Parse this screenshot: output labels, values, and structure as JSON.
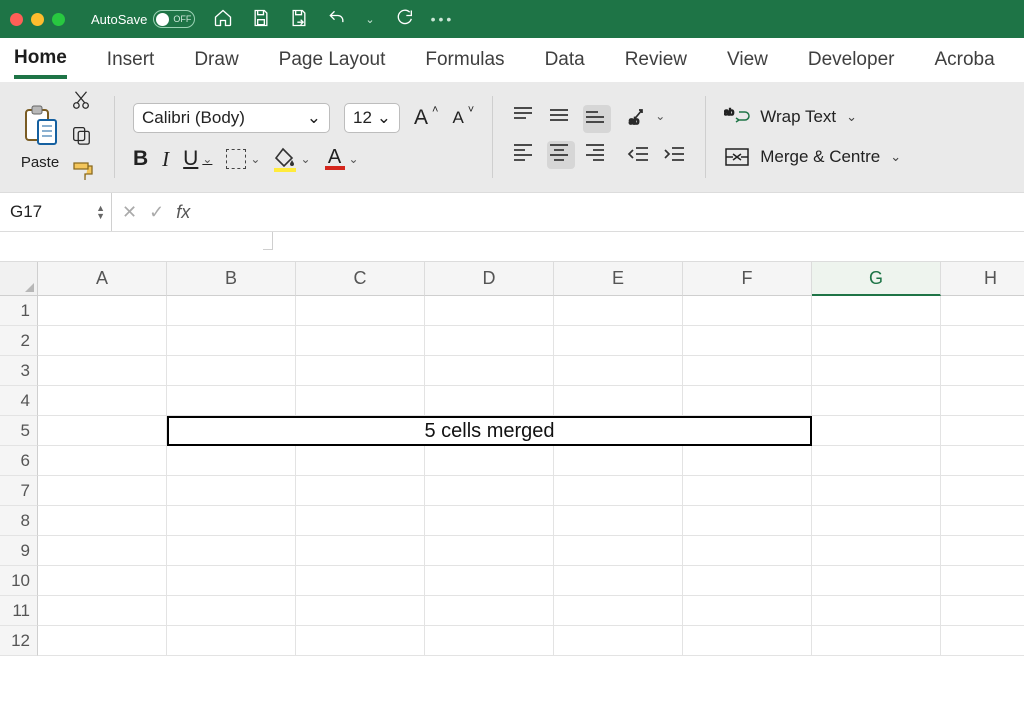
{
  "titlebar": {
    "autosave_label": "AutoSave",
    "autosave_state": "OFF"
  },
  "ribbon_tabs": [
    "Home",
    "Insert",
    "Draw",
    "Page Layout",
    "Formulas",
    "Data",
    "Review",
    "View",
    "Developer",
    "Acroba"
  ],
  "active_tab": "Home",
  "ribbon": {
    "paste_label": "Paste",
    "font_name": "Calibri (Body)",
    "font_size": "12",
    "wrap_label": "Wrap Text",
    "merge_label": "Merge & Centre"
  },
  "namebox": "G17",
  "formula": "",
  "columns": [
    "A",
    "B",
    "C",
    "D",
    "E",
    "F",
    "G",
    "H"
  ],
  "selected_column": "G",
  "rows": [
    1,
    2,
    3,
    4,
    5,
    6,
    7,
    8,
    9,
    10,
    11,
    12
  ],
  "merged_cell": {
    "text": "5 cells merged",
    "range": "B5:F5"
  }
}
